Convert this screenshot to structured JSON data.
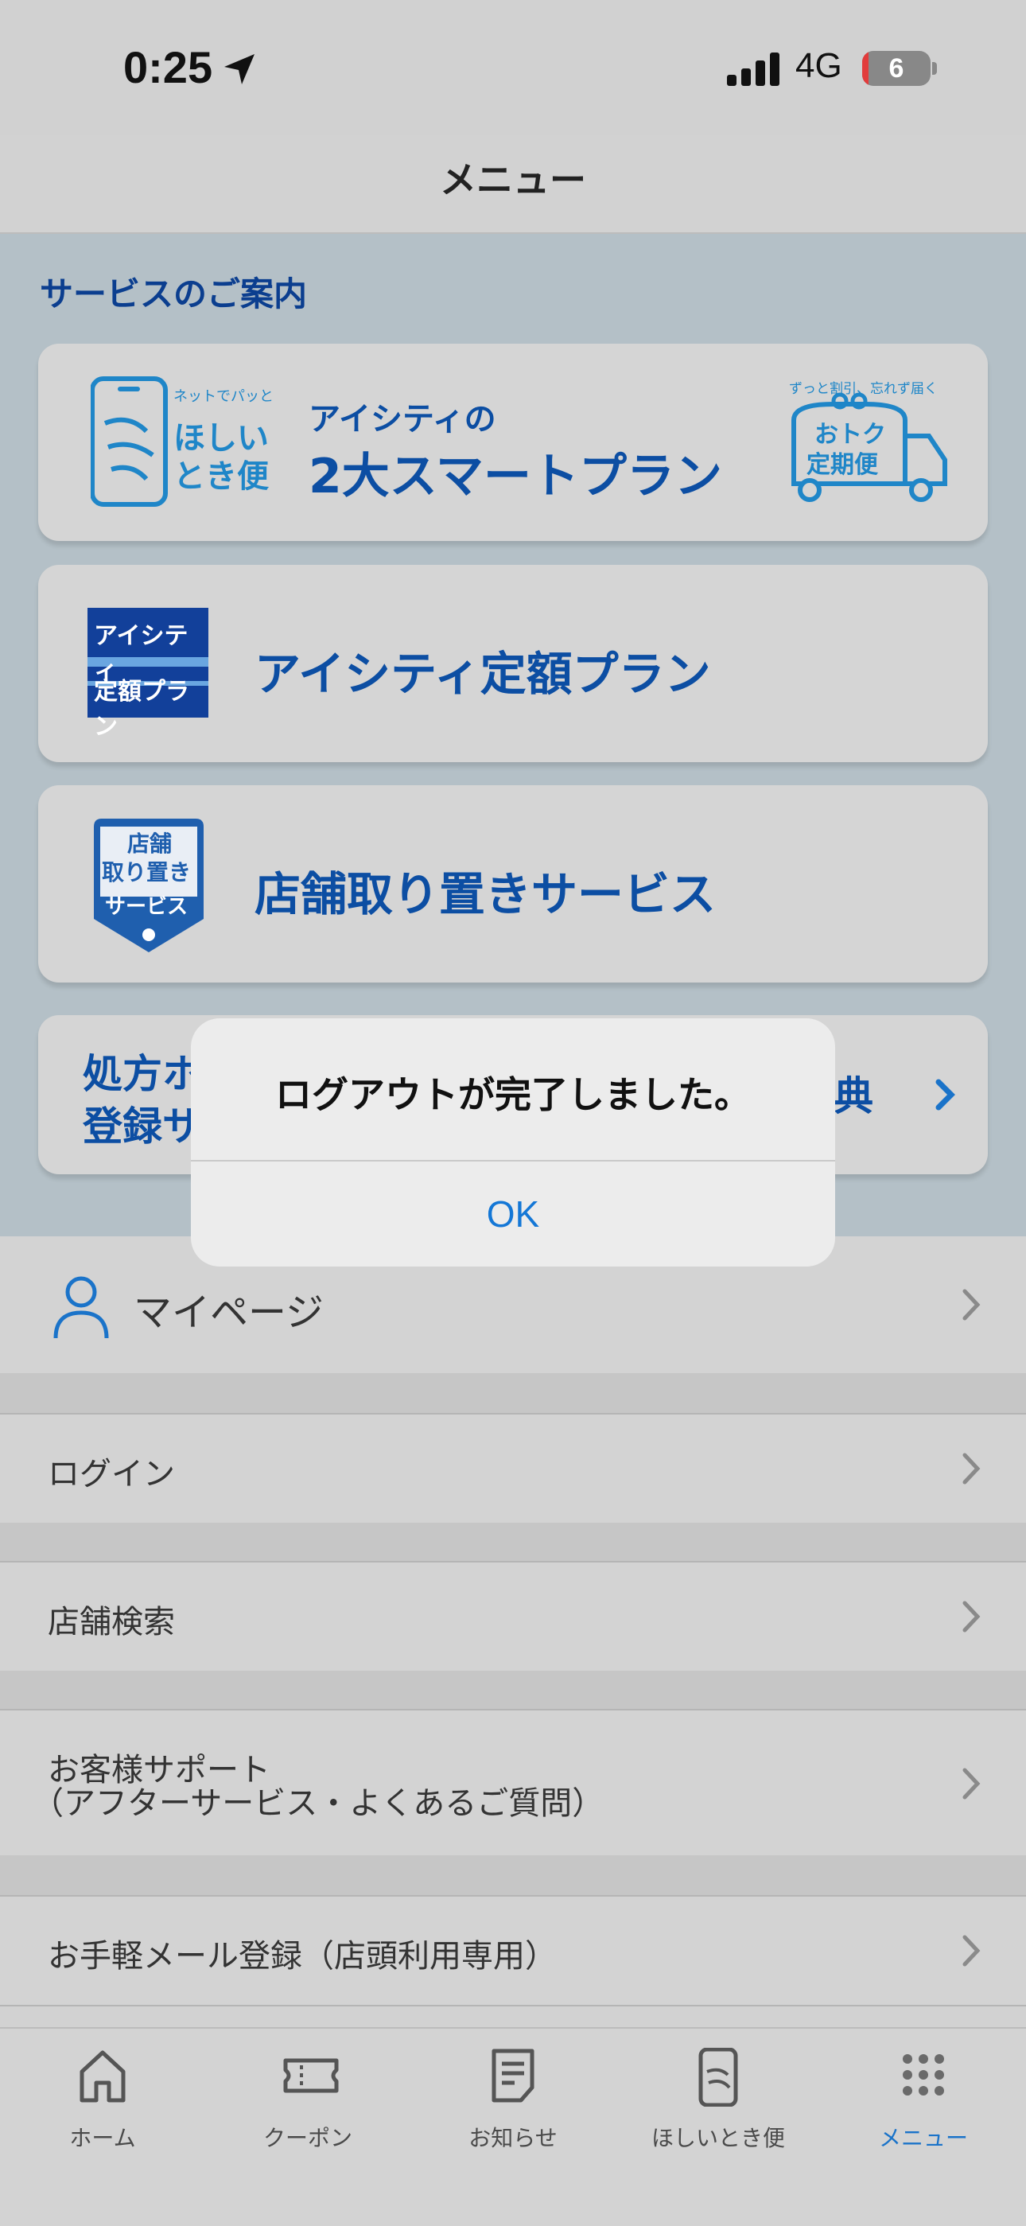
{
  "status_bar": {
    "time": "0:25",
    "network": "4G",
    "battery": "6"
  },
  "header": {
    "title": "メニュー"
  },
  "service": {
    "heading": "サービスのご案内",
    "smart_plan": {
      "badge_small": "ネットでパッと!",
      "badge_text": "ほしいとき便",
      "subtitle": "アイシティの",
      "title": "2大スマートプラン",
      "right_small": "ずっと割引、忘れず届く",
      "right_badge": "おトク定期便"
    },
    "fixed_plan": {
      "logo_line1": "アイシティ",
      "logo_line2": "定額プラン",
      "title": "アイシティ定額プラン"
    },
    "store_hold": {
      "badge_line1": "店舗",
      "badge_line2": "取り置き",
      "badge_line3": "サービス",
      "title": "店舗取り置きサービス"
    },
    "rx_card": {
      "line1": "処方ホ",
      "line2": "登録サ",
      "right": "典"
    }
  },
  "list": [
    {
      "label": "マイページ"
    },
    {
      "label": "ログイン"
    },
    {
      "label": "店舗検索"
    },
    {
      "label": "お客様サポート",
      "sub": "（アフターサービス・よくあるご質問）"
    },
    {
      "label": "お手軽メール登録（店頭利用専用）"
    }
  ],
  "tabs": [
    {
      "label": "ホーム"
    },
    {
      "label": "クーポン"
    },
    {
      "label": "お知らせ"
    },
    {
      "label": "ほしいとき便"
    },
    {
      "label": "メニュー"
    }
  ],
  "alert": {
    "message": "ログアウトが完了しました。",
    "ok": "OK"
  },
  "colors": {
    "accent": "#1a73c9",
    "brand_navy": "#0c4ea3",
    "section_bg": "#b4c0c7"
  }
}
